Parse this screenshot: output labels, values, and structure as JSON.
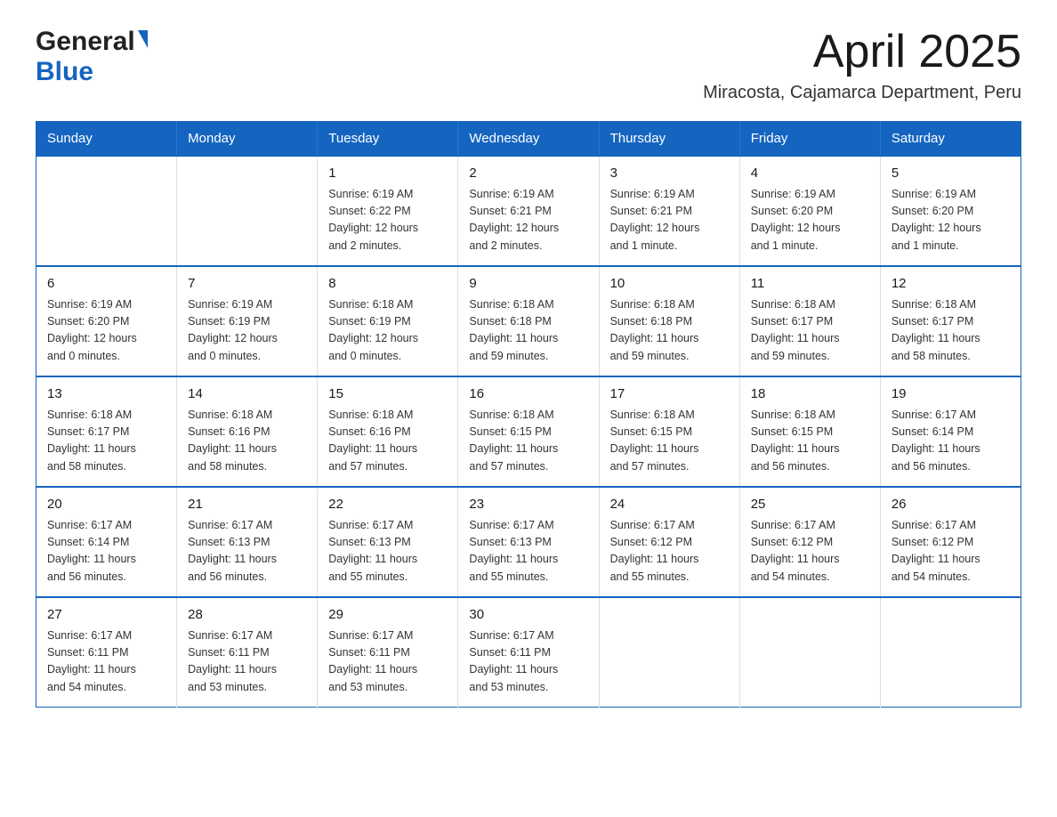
{
  "header": {
    "logo_general": "General",
    "logo_blue": "Blue",
    "month_title": "April 2025",
    "location": "Miracosta, Cajamarca Department, Peru"
  },
  "weekdays": [
    "Sunday",
    "Monday",
    "Tuesday",
    "Wednesday",
    "Thursday",
    "Friday",
    "Saturday"
  ],
  "weeks": [
    [
      {
        "day": "",
        "info": ""
      },
      {
        "day": "",
        "info": ""
      },
      {
        "day": "1",
        "info": "Sunrise: 6:19 AM\nSunset: 6:22 PM\nDaylight: 12 hours\nand 2 minutes."
      },
      {
        "day": "2",
        "info": "Sunrise: 6:19 AM\nSunset: 6:21 PM\nDaylight: 12 hours\nand 2 minutes."
      },
      {
        "day": "3",
        "info": "Sunrise: 6:19 AM\nSunset: 6:21 PM\nDaylight: 12 hours\nand 1 minute."
      },
      {
        "day": "4",
        "info": "Sunrise: 6:19 AM\nSunset: 6:20 PM\nDaylight: 12 hours\nand 1 minute."
      },
      {
        "day": "5",
        "info": "Sunrise: 6:19 AM\nSunset: 6:20 PM\nDaylight: 12 hours\nand 1 minute."
      }
    ],
    [
      {
        "day": "6",
        "info": "Sunrise: 6:19 AM\nSunset: 6:20 PM\nDaylight: 12 hours\nand 0 minutes."
      },
      {
        "day": "7",
        "info": "Sunrise: 6:19 AM\nSunset: 6:19 PM\nDaylight: 12 hours\nand 0 minutes."
      },
      {
        "day": "8",
        "info": "Sunrise: 6:18 AM\nSunset: 6:19 PM\nDaylight: 12 hours\nand 0 minutes."
      },
      {
        "day": "9",
        "info": "Sunrise: 6:18 AM\nSunset: 6:18 PM\nDaylight: 11 hours\nand 59 minutes."
      },
      {
        "day": "10",
        "info": "Sunrise: 6:18 AM\nSunset: 6:18 PM\nDaylight: 11 hours\nand 59 minutes."
      },
      {
        "day": "11",
        "info": "Sunrise: 6:18 AM\nSunset: 6:17 PM\nDaylight: 11 hours\nand 59 minutes."
      },
      {
        "day": "12",
        "info": "Sunrise: 6:18 AM\nSunset: 6:17 PM\nDaylight: 11 hours\nand 58 minutes."
      }
    ],
    [
      {
        "day": "13",
        "info": "Sunrise: 6:18 AM\nSunset: 6:17 PM\nDaylight: 11 hours\nand 58 minutes."
      },
      {
        "day": "14",
        "info": "Sunrise: 6:18 AM\nSunset: 6:16 PM\nDaylight: 11 hours\nand 58 minutes."
      },
      {
        "day": "15",
        "info": "Sunrise: 6:18 AM\nSunset: 6:16 PM\nDaylight: 11 hours\nand 57 minutes."
      },
      {
        "day": "16",
        "info": "Sunrise: 6:18 AM\nSunset: 6:15 PM\nDaylight: 11 hours\nand 57 minutes."
      },
      {
        "day": "17",
        "info": "Sunrise: 6:18 AM\nSunset: 6:15 PM\nDaylight: 11 hours\nand 57 minutes."
      },
      {
        "day": "18",
        "info": "Sunrise: 6:18 AM\nSunset: 6:15 PM\nDaylight: 11 hours\nand 56 minutes."
      },
      {
        "day": "19",
        "info": "Sunrise: 6:17 AM\nSunset: 6:14 PM\nDaylight: 11 hours\nand 56 minutes."
      }
    ],
    [
      {
        "day": "20",
        "info": "Sunrise: 6:17 AM\nSunset: 6:14 PM\nDaylight: 11 hours\nand 56 minutes."
      },
      {
        "day": "21",
        "info": "Sunrise: 6:17 AM\nSunset: 6:13 PM\nDaylight: 11 hours\nand 56 minutes."
      },
      {
        "day": "22",
        "info": "Sunrise: 6:17 AM\nSunset: 6:13 PM\nDaylight: 11 hours\nand 55 minutes."
      },
      {
        "day": "23",
        "info": "Sunrise: 6:17 AM\nSunset: 6:13 PM\nDaylight: 11 hours\nand 55 minutes."
      },
      {
        "day": "24",
        "info": "Sunrise: 6:17 AM\nSunset: 6:12 PM\nDaylight: 11 hours\nand 55 minutes."
      },
      {
        "day": "25",
        "info": "Sunrise: 6:17 AM\nSunset: 6:12 PM\nDaylight: 11 hours\nand 54 minutes."
      },
      {
        "day": "26",
        "info": "Sunrise: 6:17 AM\nSunset: 6:12 PM\nDaylight: 11 hours\nand 54 minutes."
      }
    ],
    [
      {
        "day": "27",
        "info": "Sunrise: 6:17 AM\nSunset: 6:11 PM\nDaylight: 11 hours\nand 54 minutes."
      },
      {
        "day": "28",
        "info": "Sunrise: 6:17 AM\nSunset: 6:11 PM\nDaylight: 11 hours\nand 53 minutes."
      },
      {
        "day": "29",
        "info": "Sunrise: 6:17 AM\nSunset: 6:11 PM\nDaylight: 11 hours\nand 53 minutes."
      },
      {
        "day": "30",
        "info": "Sunrise: 6:17 AM\nSunset: 6:11 PM\nDaylight: 11 hours\nand 53 minutes."
      },
      {
        "day": "",
        "info": ""
      },
      {
        "day": "",
        "info": ""
      },
      {
        "day": "",
        "info": ""
      }
    ]
  ]
}
